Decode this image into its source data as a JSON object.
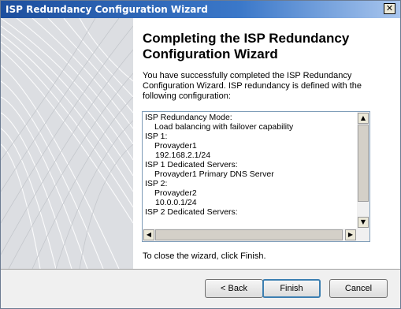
{
  "window": {
    "title": "ISP Redundancy Configuration Wizard",
    "close_glyph": "✕"
  },
  "page": {
    "heading": "Completing the ISP Redundancy Configuration Wizard",
    "intro": "You have successfully completed the ISP Redundancy Configuration Wizard. ISP redundancy is defined with the following configuration:",
    "config_lines": [
      {
        "level": 1,
        "text": "ISP Redundancy Mode:"
      },
      {
        "level": 2,
        "text": "Load balancing with failover capability"
      },
      {
        "level": 1,
        "text": "ISP 1:"
      },
      {
        "level": 2,
        "text": "Provayder1"
      },
      {
        "level": 3,
        "text": "192.168.2.1/24"
      },
      {
        "level": 1,
        "text": "ISP 1 Dedicated Servers:"
      },
      {
        "level": 2,
        "text": "Provayder1 Primary DNS Server"
      },
      {
        "level": 1,
        "text": "ISP 2:"
      },
      {
        "level": 2,
        "text": "Provayder2"
      },
      {
        "level": 3,
        "text": "10.0.0.1/24"
      },
      {
        "level": 1,
        "text": "ISP 2 Dedicated Servers:"
      }
    ],
    "closing": "To close the wizard, click Finish."
  },
  "buttons": {
    "back": "< Back",
    "finish": "Finish",
    "cancel": "Cancel"
  },
  "icons": {
    "scroll_up": "up-arrow-icon",
    "scroll_down": "down-arrow-icon",
    "scroll_left": "left-arrow-icon",
    "scroll_right": "right-arrow-icon"
  }
}
